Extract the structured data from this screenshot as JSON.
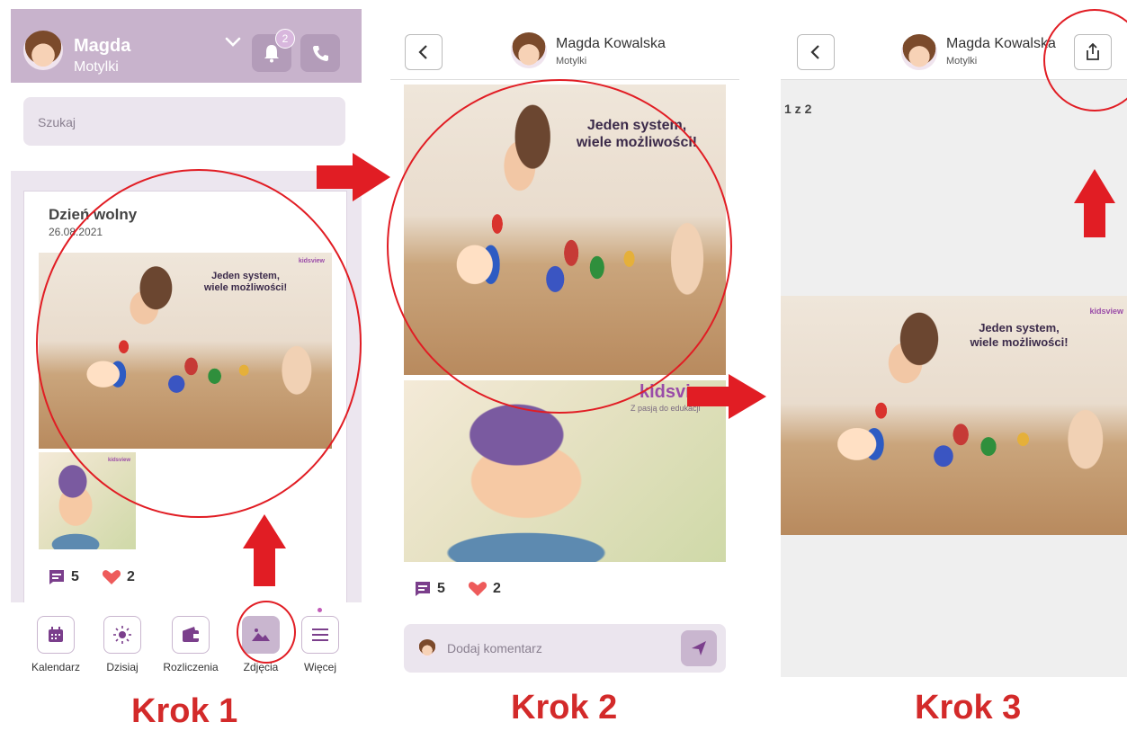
{
  "panel1": {
    "header": {
      "name": "Magda",
      "group": "Motylki",
      "notification_count": "2"
    },
    "search": {
      "placeholder": "Szukaj"
    },
    "post": {
      "title": "Dzień wolny",
      "date": "26.08.2021",
      "comments": "5",
      "likes": "2"
    },
    "photo_text": {
      "line1": "Jeden system,",
      "line2": "wiele możliwości!",
      "logo": "kidsview"
    },
    "nav": [
      {
        "label": "Kalendarz",
        "icon": "calendar-icon"
      },
      {
        "label": "Dzisiaj",
        "icon": "sun-icon"
      },
      {
        "label": "Rozliczenia",
        "icon": "wallet-icon"
      },
      {
        "label": "Zdjęcia",
        "icon": "image-icon"
      },
      {
        "label": "Więcej",
        "icon": "menu-icon"
      }
    ]
  },
  "panel2": {
    "header": {
      "name": "Magda Kowalska",
      "group": "Motylki"
    },
    "photo_text": {
      "line1": "Jeden system,",
      "line2": "wiele możliwości!",
      "logo": "kidsview",
      "logo_sub": "Z pasją do edukacji"
    },
    "comments": "5",
    "likes": "2",
    "comment_input": {
      "placeholder": "Dodaj komentarz"
    }
  },
  "panel3": {
    "header": {
      "name": "Magda Kowalska",
      "group": "Motylki"
    },
    "counter": "1 z 2",
    "photo_text": {
      "line1": "Jeden system,",
      "line2": "wiele możliwości!",
      "logo": "kidsview"
    }
  },
  "steps": [
    "Krok 1",
    "Krok 2",
    "Krok 3"
  ],
  "colors": {
    "header_bg": "#c8b3cc",
    "accent_purple": "#7b3f8c",
    "annotation_red": "#e11d24"
  }
}
